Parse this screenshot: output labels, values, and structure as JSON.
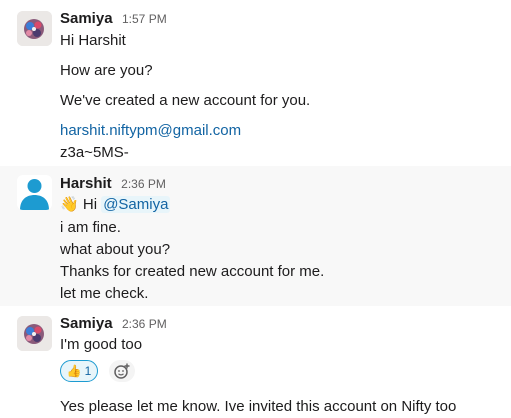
{
  "messages": [
    {
      "author": "Samiya",
      "time": "1:57 PM",
      "avatar_icon": "photo-avatar-icon",
      "lines": [
        "Hi Harshit",
        "How are you?",
        "We've created a new account for you.",
        "harshit.niftypm@gmail.com",
        "z3a~5MS-"
      ]
    },
    {
      "author": "Harshit",
      "time": "2:36 PM",
      "avatar_icon": "person-avatar-icon",
      "greeting_emoji": "👋",
      "greeting_text": "Hi",
      "mention": "@Samiya",
      "lines": [
        "i am fine.",
        "what about you?",
        "Thanks for created new account for me.",
        "let me check."
      ]
    },
    {
      "author": "Samiya",
      "time": "2:36 PM",
      "avatar_icon": "photo-avatar-icon",
      "lines": [
        "I'm good too",
        "Yes please let me know. Ive invited this account on Nifty too"
      ],
      "reaction": {
        "emoji": "👍",
        "count": "1"
      },
      "add_reaction_icon": "add-reaction-icon"
    }
  ],
  "colors": {
    "link": "#1264a3",
    "highlight_bg": "#f8f8f8",
    "avatar_blue": "#1d9bd1"
  }
}
